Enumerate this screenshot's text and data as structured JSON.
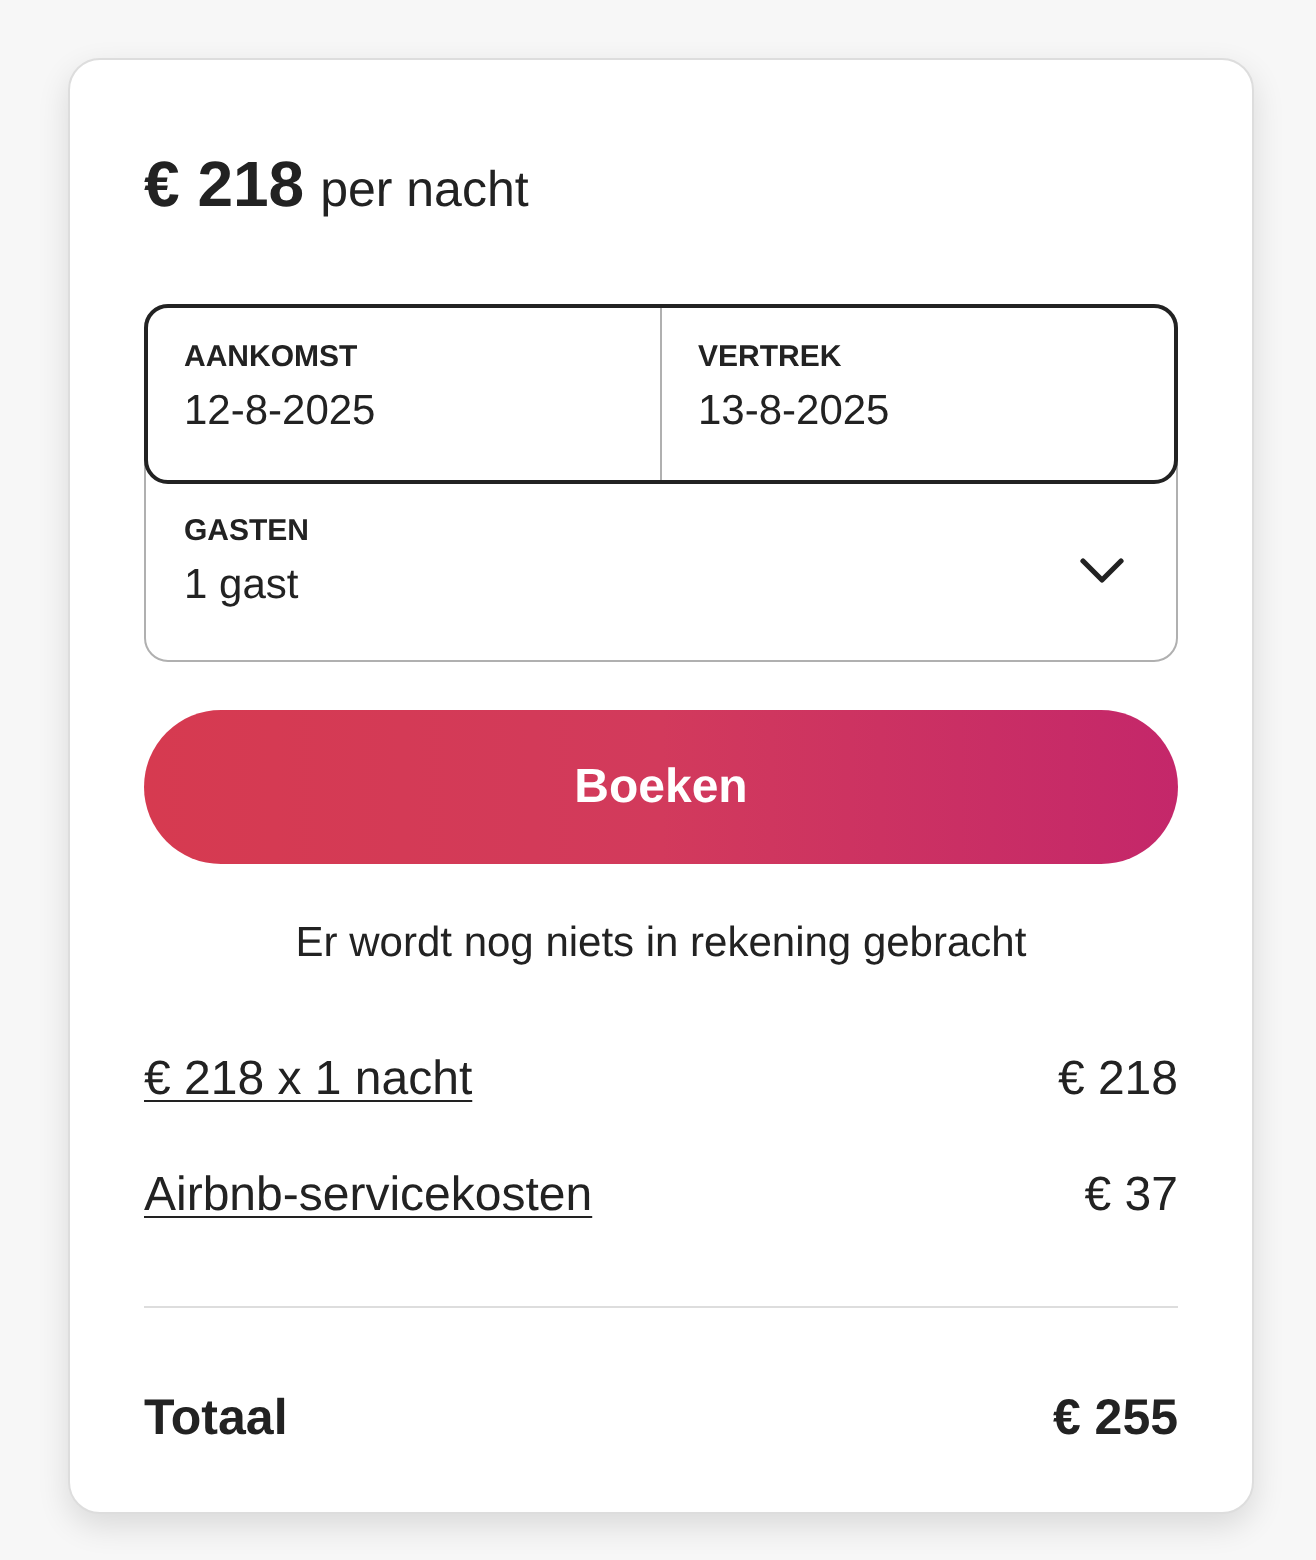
{
  "price": {
    "amount": "€ 218",
    "unit": "per nacht"
  },
  "dates": {
    "selected": true,
    "fields": [
      {
        "label": "AANKOMST",
        "value": "12-8-2025"
      },
      {
        "label": "VERTREK",
        "value": "13-8-2025"
      }
    ]
  },
  "guests": {
    "label": "GASTEN",
    "value": "1 gast"
  },
  "book_button": {
    "label": "Boeken"
  },
  "note": "Er wordt nog niets in rekening gebracht",
  "fees": [
    {
      "label": "€ 218 x 1 nacht",
      "amount": "€ 218"
    },
    {
      "label": "Airbnb-servicekosten",
      "amount": "€ 37"
    }
  ],
  "total": {
    "label": "Totaal",
    "amount": "€ 255"
  }
}
